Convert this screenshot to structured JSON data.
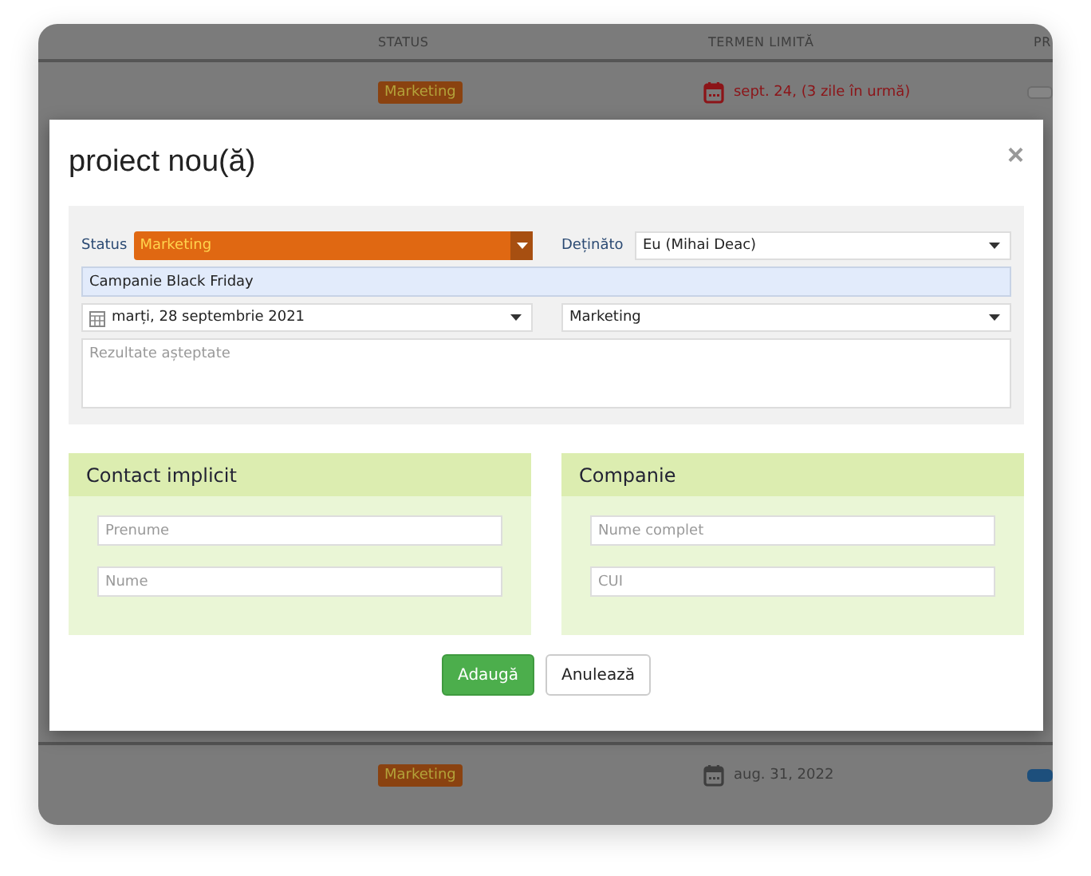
{
  "background_table": {
    "columns": [
      "STATUS",
      "TERMEN LIMITĂ",
      "PR"
    ],
    "rows": [
      {
        "status": "Marketing",
        "due": "sept. 24, (3 zile în urmă)",
        "overdue": true,
        "toggle_on": false
      }
    ],
    "footer_rows": [
      {
        "status": "Marketing",
        "due": "aug. 31, 2022",
        "overdue": false,
        "toggle_on": true
      }
    ]
  },
  "dialog": {
    "title": "proiect nou(ă)",
    "close": "×",
    "status_label": "Status",
    "status_value": "Marketing",
    "owner_label": "Deținăto",
    "owner_value": "Eu (Mihai Deac)",
    "name_value": "Campanie Black Friday",
    "date_value": "marți, 28 septembrie 2021",
    "category_value": "Marketing",
    "results_placeholder": "Rezultate așteptate",
    "sections": [
      {
        "title": "Contact implicit",
        "fields": [
          {
            "placeholder": "Prenume"
          },
          {
            "placeholder": "Nume"
          }
        ]
      },
      {
        "title": "Companie",
        "fields": [
          {
            "placeholder": "Nume complet"
          },
          {
            "placeholder": "CUI"
          }
        ]
      }
    ],
    "buttons": [
      {
        "label": "Adaugă",
        "kind": "primary"
      },
      {
        "label": "Anulează",
        "kind": "secondary"
      }
    ]
  }
}
